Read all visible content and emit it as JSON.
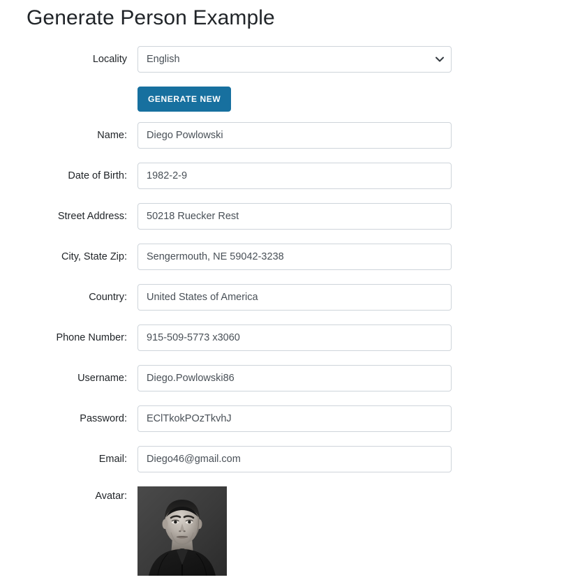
{
  "page": {
    "title": "Generate Person Example"
  },
  "locality": {
    "label": "Locality",
    "selected": "English",
    "options": [
      "English"
    ],
    "arrow_icon": "chevron-down-icon"
  },
  "generate_button": {
    "label": "Generate New"
  },
  "fields": [
    {
      "label": "Name:",
      "value": "Diego Powlowski"
    },
    {
      "label": "Date of Birth:",
      "value": "1982-2-9"
    },
    {
      "label": "Street Address:",
      "value": "50218 Ruecker Rest"
    },
    {
      "label": "City, State Zip:",
      "value": "Sengermouth, NE 59042-3238"
    },
    {
      "label": "Country:",
      "value": "United States of America"
    },
    {
      "label": "Phone Number:",
      "value": "915-509-5773 x3060"
    },
    {
      "label": "Username:",
      "value": "Diego.Powlowski86"
    },
    {
      "label": "Password:",
      "value": "EClTkokPOzTkvhJ"
    },
    {
      "label": "Email:",
      "value": "Diego46@gmail.com"
    }
  ],
  "avatar": {
    "label": "Avatar:",
    "icon": "avatar-portrait-photo"
  },
  "colors": {
    "button": "#17709f",
    "border": "#ced4da",
    "text": "#212529",
    "input_text": "#495057"
  }
}
